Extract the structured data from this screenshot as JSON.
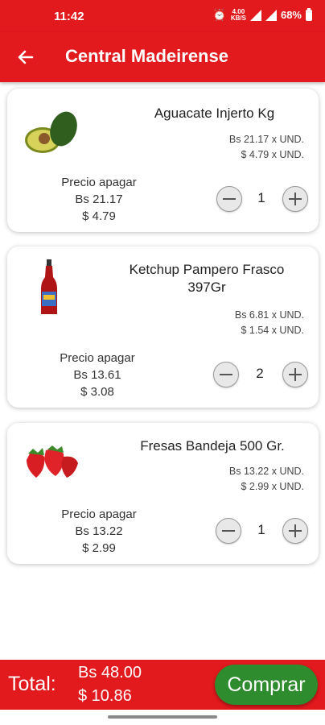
{
  "status_bar": {
    "time": "11:42",
    "network_top": "4.00",
    "network_bottom": "KB/S",
    "battery": "68%"
  },
  "app_bar": {
    "title": "Central Madeirense"
  },
  "colors": {
    "primary": "#e2191d",
    "buy_button": "#2e8b2e"
  },
  "products": [
    {
      "name_lines": [
        "Aguacate Injerto Kg"
      ],
      "unit_price_bs": "Bs 21.17 x UND.",
      "unit_price_usd": "$ 4.79 x UND.",
      "pay_label": "Precio apagar",
      "pay_bs": "Bs 21.17",
      "pay_usd": "$ 4.79",
      "quantity": "1",
      "image": "avocado"
    },
    {
      "name_lines": [
        "Ketchup Pampero Frasco",
        "397Gr"
      ],
      "unit_price_bs": "Bs 6.81 x UND.",
      "unit_price_usd": "$ 1.54 x UND.",
      "pay_label": "Precio apagar",
      "pay_bs": "Bs 13.61",
      "pay_usd": "$ 3.08",
      "quantity": "2",
      "image": "ketchup-bottle"
    },
    {
      "name_lines": [
        "Fresas Bandeja 500 Gr."
      ],
      "unit_price_bs": "Bs 13.22 x UND.",
      "unit_price_usd": "$ 2.99 x UND.",
      "pay_label": "Precio apagar",
      "pay_bs": "Bs 13.22",
      "pay_usd": "$ 2.99",
      "quantity": "1",
      "image": "strawberries"
    }
  ],
  "footer": {
    "total_label": "Total:",
    "total_bs": "Bs 48.00",
    "total_usd": "$ 10.86",
    "buy_label": "Comprar"
  }
}
